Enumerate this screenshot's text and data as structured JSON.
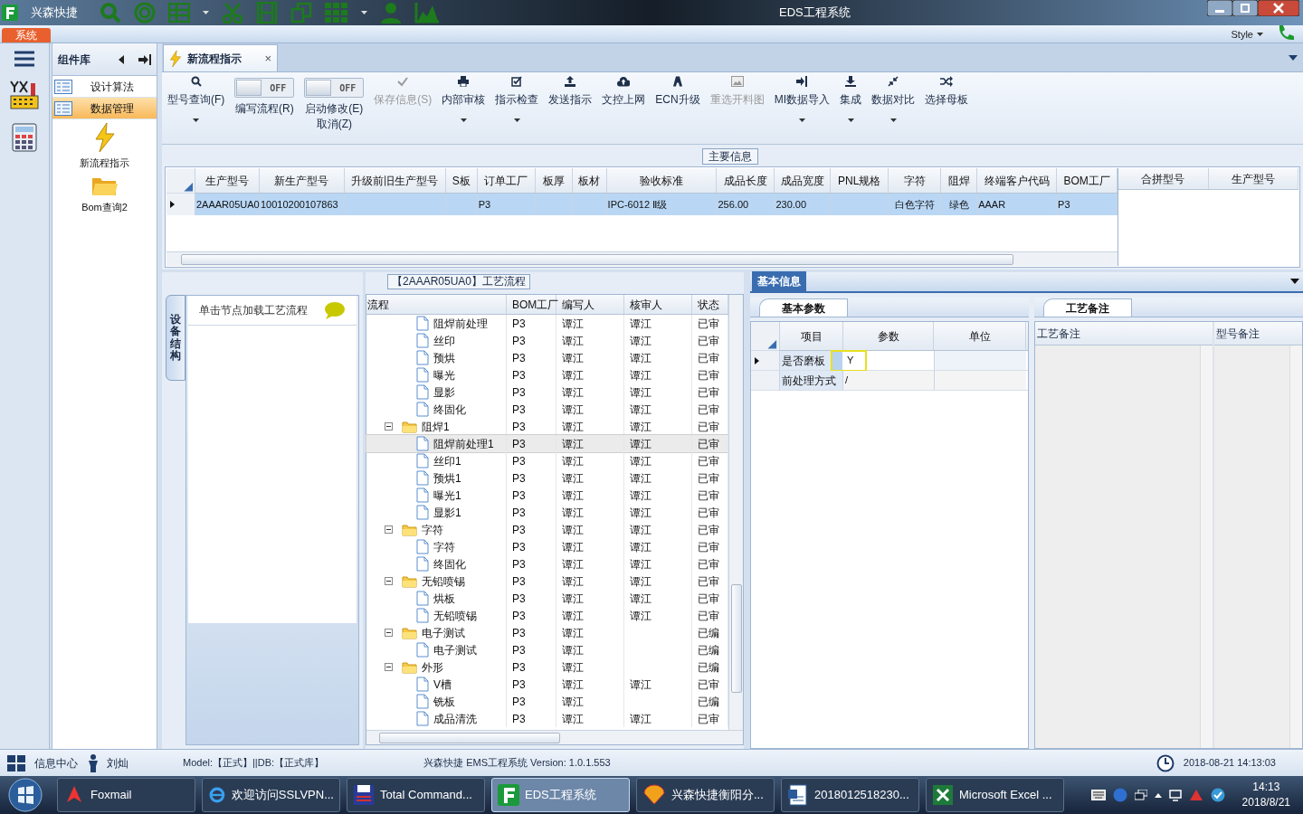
{
  "title_bar": {
    "app_name": "兴森快捷",
    "title": "EDS工程系统"
  },
  "menu_bar": {
    "tab": "系统",
    "style": "Style"
  },
  "component_panel": {
    "title": "组件库",
    "items": [
      {
        "label": "设计算法",
        "selected": false
      },
      {
        "label": "数据管理",
        "selected": true
      }
    ],
    "tools": [
      {
        "label": "新流程指示"
      },
      {
        "label": "Bom查询2"
      }
    ]
  },
  "document_tab": {
    "label": "新流程指示",
    "close": "×"
  },
  "toolbar": [
    {
      "kind": "button",
      "label": "型号查询(F)",
      "disabled": false,
      "dropdown": true
    },
    {
      "kind": "toggle",
      "label": "编写流程(R)",
      "switch": "OFF",
      "on": false
    },
    {
      "kind": "toggle",
      "label": "启动修改(E)\n取消(Z)",
      "switch": "OFF",
      "on": false
    },
    {
      "kind": "button",
      "label": "保存信息(S)",
      "disabled": true,
      "dropdown": false
    },
    {
      "kind": "button",
      "label": "内部审核",
      "disabled": false,
      "dropdown": true
    },
    {
      "kind": "button",
      "label": "指示检查",
      "disabled": false,
      "dropdown": true
    },
    {
      "kind": "button",
      "label": "发送指示",
      "disabled": false,
      "dropdown": false
    },
    {
      "kind": "button",
      "label": "文控上网",
      "disabled": false,
      "dropdown": false
    },
    {
      "kind": "button",
      "label": "ECN升级",
      "disabled": false,
      "dropdown": false
    },
    {
      "kind": "button",
      "label": "重选开料图",
      "disabled": true,
      "dropdown": false
    },
    {
      "kind": "button",
      "label": "MI数据导入",
      "disabled": false,
      "dropdown": true
    },
    {
      "kind": "button",
      "label": "集成",
      "disabled": false,
      "dropdown": true
    },
    {
      "kind": "button",
      "label": "数据对比",
      "disabled": false,
      "dropdown": true
    },
    {
      "kind": "button",
      "label": "选择母板",
      "disabled": false,
      "dropdown": false
    }
  ],
  "main_info": {
    "title": "主要信息",
    "columns": [
      "生产型号",
      "新生产型号",
      "升级前旧生产型号",
      "S板",
      "订单工厂",
      "板厚",
      "板材",
      "验收标准",
      "成品长度",
      "成品宽度",
      "PNL规格",
      "字符",
      "阻焊",
      "终端客户代码",
      "BOM工厂"
    ],
    "rows": [
      {
        "selected": true,
        "cells": [
          "2AAAR05UA0",
          "10010200107863",
          null,
          null,
          "P3",
          null,
          null,
          "IPC-6012 Ⅱ级",
          "256.00",
          "230.00",
          null,
          "白色字符",
          "绿色",
          "AAAR",
          "P3"
        ]
      }
    ],
    "side_columns": [
      "合拼型号",
      "生产型号"
    ]
  },
  "process": {
    "side_tab": "设备结构",
    "hint": "单击节点加载工艺流程",
    "title": "【2AAAR05UA0】工艺流程",
    "columns": [
      "流程",
      "BOM工厂",
      "编写人",
      "核审人",
      "状态"
    ],
    "tree": [
      {
        "children": [
          {
            "kind": "file",
            "label": "阻焊前处理",
            "bom": "P3",
            "writer": "谭江",
            "reviewer": "谭江",
            "status": "已审",
            "selected": false
          },
          {
            "kind": "file",
            "label": "丝印",
            "bom": "P3",
            "writer": "谭江",
            "reviewer": "谭江",
            "status": "已审",
            "selected": false
          },
          {
            "kind": "file",
            "label": "预烘",
            "bom": "P3",
            "writer": "谭江",
            "reviewer": "谭江",
            "status": "已审",
            "selected": false
          },
          {
            "kind": "file",
            "label": "曝光",
            "bom": "P3",
            "writer": "谭江",
            "reviewer": "谭江",
            "status": "已审",
            "selected": false
          },
          {
            "kind": "file",
            "label": "显影",
            "bom": "P3",
            "writer": "谭江",
            "reviewer": "谭江",
            "status": "已审",
            "selected": false
          },
          {
            "kind": "file",
            "label": "终固化",
            "bom": "P3",
            "writer": "谭江",
            "reviewer": "谭江",
            "status": "已审",
            "selected": false
          }
        ]
      },
      {
        "kind": "folder",
        "label": "阻焊1",
        "bom": "P3",
        "writer": "谭江",
        "reviewer": "谭江",
        "status": "已审",
        "selected": false,
        "expanded": true,
        "children": [
          {
            "kind": "file",
            "label": "阻焊前处理1",
            "bom": "P3",
            "writer": "谭江",
            "reviewer": "谭江",
            "status": "已审",
            "selected": true
          },
          {
            "kind": "file",
            "label": "丝印1",
            "bom": "P3",
            "writer": "谭江",
            "reviewer": "谭江",
            "status": "已审",
            "selected": false
          },
          {
            "kind": "file",
            "label": "预烘1",
            "bom": "P3",
            "writer": "谭江",
            "reviewer": "谭江",
            "status": "已审",
            "selected": false
          },
          {
            "kind": "file",
            "label": "曝光1",
            "bom": "P3",
            "writer": "谭江",
            "reviewer": "谭江",
            "status": "已审",
            "selected": false
          },
          {
            "kind": "file",
            "label": "显影1",
            "bom": "P3",
            "writer": "谭江",
            "reviewer": "谭江",
            "status": "已审",
            "selected": false
          }
        ]
      },
      {
        "kind": "folder",
        "label": "字符",
        "bom": "P3",
        "writer": "谭江",
        "reviewer": "谭江",
        "status": "已审",
        "selected": false,
        "expanded": true,
        "children": [
          {
            "kind": "file",
            "label": "字符",
            "bom": "P3",
            "writer": "谭江",
            "reviewer": "谭江",
            "status": "已审",
            "selected": false
          },
          {
            "kind": "file",
            "label": "终固化",
            "bom": "P3",
            "writer": "谭江",
            "reviewer": "谭江",
            "status": "已审",
            "selected": false
          }
        ]
      },
      {
        "kind": "folder",
        "label": "无铅喷锡",
        "bom": "P3",
        "writer": "谭江",
        "reviewer": "谭江",
        "status": "已审",
        "selected": false,
        "expanded": true,
        "children": [
          {
            "kind": "file",
            "label": "烘板",
            "bom": "P3",
            "writer": "谭江",
            "reviewer": "谭江",
            "status": "已审",
            "selected": false
          },
          {
            "kind": "file",
            "label": "无铅喷锡",
            "bom": "P3",
            "writer": "谭江",
            "reviewer": "谭江",
            "status": "已审",
            "selected": false
          }
        ]
      },
      {
        "kind": "folder",
        "label": "电子测试",
        "bom": "P3",
        "writer": "谭江",
        "status": "已编",
        "selected": false,
        "expanded": true,
        "children": [
          {
            "kind": "file",
            "label": "电子测试",
            "bom": "P3",
            "writer": "谭江",
            "status": "已编",
            "selected": false
          }
        ]
      },
      {
        "kind": "folder",
        "label": "外形",
        "bom": "P3",
        "writer": "谭江",
        "status": "已编",
        "selected": false,
        "expanded": true,
        "children": [
          {
            "kind": "file",
            "label": "V槽",
            "bom": "P3",
            "writer": "谭江",
            "reviewer": "谭江",
            "status": "已审",
            "selected": false
          },
          {
            "kind": "file",
            "label": "铣板",
            "bom": "P3",
            "writer": "谭江",
            "status": "已编",
            "selected": false
          },
          {
            "kind": "file",
            "label": "成品清洗",
            "bom": "P3",
            "writer": "谭江",
            "reviewer": "谭江",
            "status": "已审",
            "selected": false
          }
        ]
      }
    ]
  },
  "basic_info": {
    "tab": "基本信息",
    "params": {
      "tab": "基本参数",
      "columns": [
        "项目",
        "参数",
        "单位"
      ],
      "rows": [
        {
          "item": "是否磨板",
          "value": "Y",
          "selected": true
        },
        {
          "item": "前处理方式",
          "value": "/",
          "selected": false
        }
      ]
    },
    "notes": {
      "tab": "工艺备注",
      "columns": [
        "工艺备注",
        "型号备注"
      ]
    }
  },
  "status_bar": {
    "info_center": "信息中心",
    "user": "刘灿",
    "model": "Model:【正式】||DB:【正式库】",
    "version": "兴森快捷 EMS工程系统 Version: 1.0.1.553",
    "datetime": "2018-08-21 14:13:03"
  },
  "taskbar": {
    "items": [
      {
        "label": "Foxmail",
        "selected": false
      },
      {
        "label": "欢迎访问SSLVPN...",
        "selected": false
      },
      {
        "label": "Total Command...",
        "selected": false
      },
      {
        "label": "EDS工程系统",
        "selected": true
      },
      {
        "label": "兴森快捷衡阳分...",
        "selected": false
      },
      {
        "label": "2018012518230...",
        "selected": false
      },
      {
        "label": "Microsoft Excel ...",
        "selected": false
      }
    ],
    "time": "14:13",
    "date": "2018/8/21"
  }
}
